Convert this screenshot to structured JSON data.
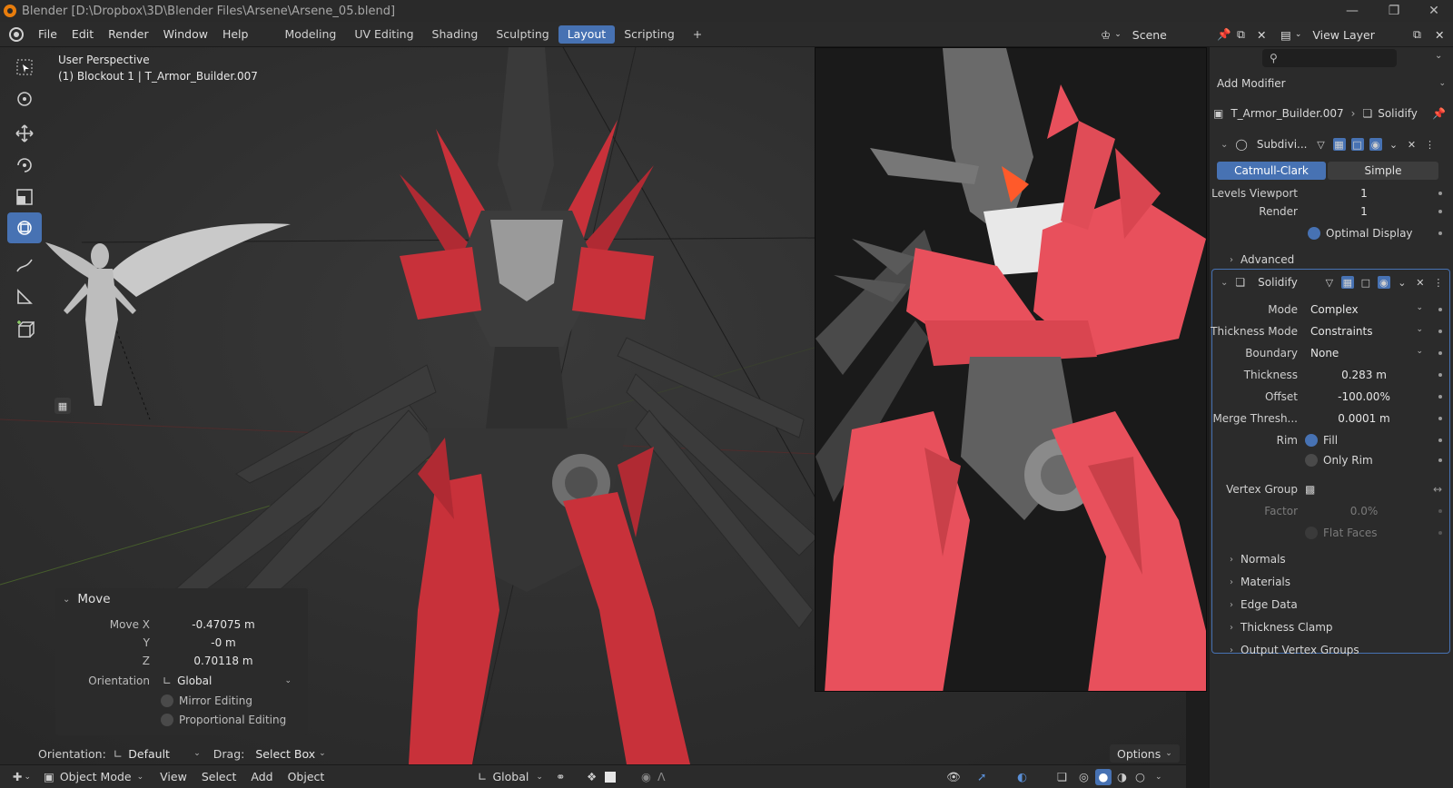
{
  "window": {
    "title": "Blender [D:\\Dropbox\\3D\\Blender Files\\Arsene\\Arsene_05.blend]"
  },
  "menubar": {
    "menus": [
      "File",
      "Edit",
      "Render",
      "Window",
      "Help"
    ],
    "workspaces": [
      "Modeling",
      "UV Editing",
      "Shading",
      "Sculpting",
      "Layout",
      "Scripting"
    ],
    "active_workspace": "Layout",
    "add_tab": "+",
    "scene_label": "Scene",
    "view_layer_label": "View Layer"
  },
  "viewport": {
    "perspective": "User Perspective",
    "object_info": "(1) Blockout 1 | T_Armor_Builder.007"
  },
  "move_panel": {
    "title": "Move",
    "move_x_label": "Move X",
    "move_x": "-0.47075 m",
    "y_label": "Y",
    "y": "-0 m",
    "z_label": "Z",
    "z": "0.70118 m",
    "orientation_label": "Orientation",
    "orientation": "Global",
    "mirror_editing": "Mirror Editing",
    "proportional_editing": "Proportional Editing"
  },
  "viewport_footer": {
    "orientation_label": "Orientation:",
    "orientation_value": "Default",
    "drag_label": "Drag:",
    "drag_value": "Select Box",
    "options": "Options"
  },
  "bottombar": {
    "mode": "Object Mode",
    "menus": [
      "View",
      "Select",
      "Add",
      "Object"
    ],
    "transform_orientation": "Global"
  },
  "properties": {
    "add_modifier": "Add Modifier",
    "object_name": "T_Armor_Builder.007",
    "active_modifier": "Solidify",
    "subdiv": {
      "name": "Subdivi...",
      "type_options": [
        "Catmull-Clark",
        "Simple"
      ],
      "selected_type": "Catmull-Clark",
      "levels_viewport_label": "Levels Viewport",
      "levels_viewport": "1",
      "render_label": "Render",
      "render": "1",
      "optimal_display": "Optimal Display",
      "advanced": "Advanced"
    },
    "solidify": {
      "name": "Solidify",
      "mode_label": "Mode",
      "mode": "Complex",
      "thickness_mode_label": "Thickness Mode",
      "thickness_mode": "Constraints",
      "boundary_label": "Boundary",
      "boundary": "None",
      "thickness_label": "Thickness",
      "thickness": "0.283 m",
      "offset_label": "Offset",
      "offset": "-100.00%",
      "merge_label": "Merge Thresh...",
      "merge": "0.0001 m",
      "rim_label": "Rim",
      "fill": "Fill",
      "only_rim": "Only Rim",
      "vertex_group_label": "Vertex Group",
      "factor_label": "Factor",
      "factor": "0.0%",
      "flat_faces": "Flat Faces",
      "subpanels": [
        "Normals",
        "Materials",
        "Edge Data",
        "Thickness Clamp",
        "Output Vertex Groups"
      ]
    }
  },
  "colors": {
    "accent": "#4772b3",
    "armor_red": "#c8313a",
    "ref_red": "#e8505c",
    "armor_dark": "#3a3a3a"
  }
}
